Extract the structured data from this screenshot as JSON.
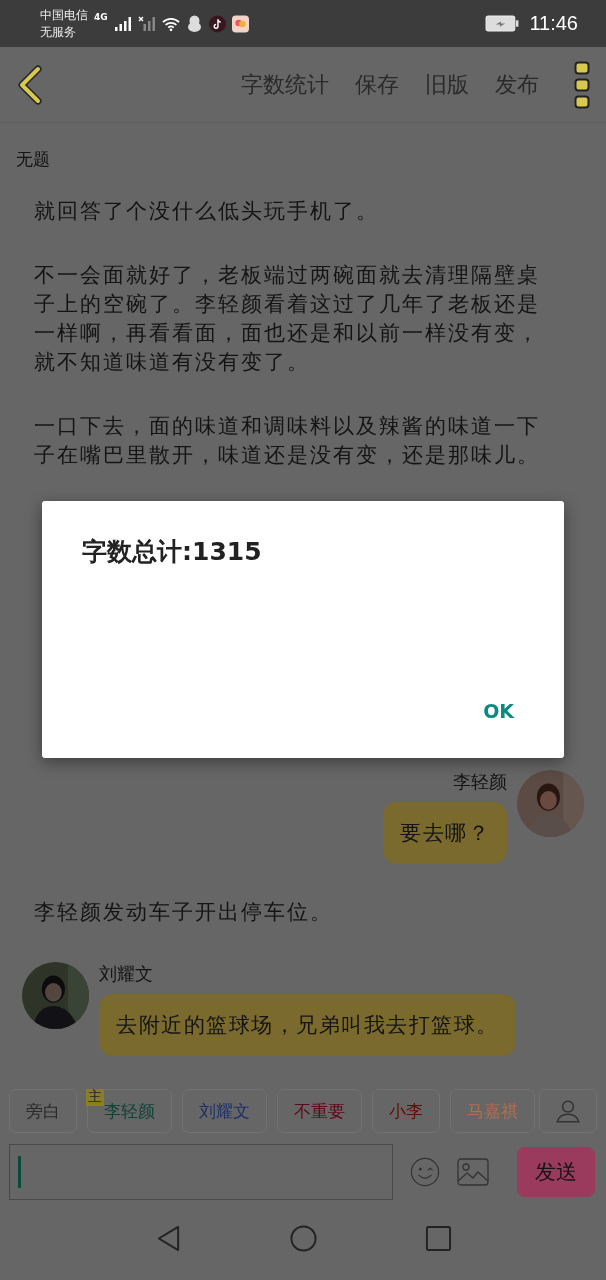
{
  "status_bar": {
    "carrier": "中国电信",
    "service": "无服务",
    "network": "4G",
    "time": "11:46"
  },
  "toolbar": {
    "actions": [
      "字数统计",
      "保存",
      "旧版",
      "发布"
    ]
  },
  "document": {
    "title": "无题"
  },
  "content": [
    {
      "kind": "narration",
      "text": "就回答了个没什么低头玩手机了。"
    },
    {
      "kind": "narration",
      "text": "不一会面就好了，老板端过两碗面就去清理隔壁桌子上的空碗了。李轻颜看着这过了几年了老板还是一样啊，再看看面，面也还是和以前一样没有变，就不知道味道有没有变了。"
    },
    {
      "kind": "narration",
      "text": "一口下去，面的味道和调味料以及辣酱的味道一下子在嘴巴里散开，味道还是没有变，还是那味儿。"
    },
    {
      "kind": "hidden"
    },
    {
      "kind": "outgoing",
      "speaker": "李轻颜",
      "text": "要去哪？"
    },
    {
      "kind": "narration",
      "text": "李轻颜发动车子开出停车位。"
    },
    {
      "kind": "incoming",
      "speaker": "刘耀文",
      "text": "去附近的篮球场，兄弟叫我去打篮球。"
    }
  ],
  "characters": [
    {
      "label": "旁白",
      "color": "#2a2a2a"
    },
    {
      "label": "李轻颜",
      "color": "#0c4438",
      "badge": "主"
    },
    {
      "label": "刘耀文",
      "color": "#1f2e6a"
    },
    {
      "label": "不重要",
      "color": "#5e0818"
    },
    {
      "label": "小李",
      "color": "#600c06"
    },
    {
      "label": "马嘉祺",
      "color": "#b07050"
    }
  ],
  "composer": {
    "send": "发送"
  },
  "dialog": {
    "message": "字数总计:1315",
    "button": "OK"
  }
}
